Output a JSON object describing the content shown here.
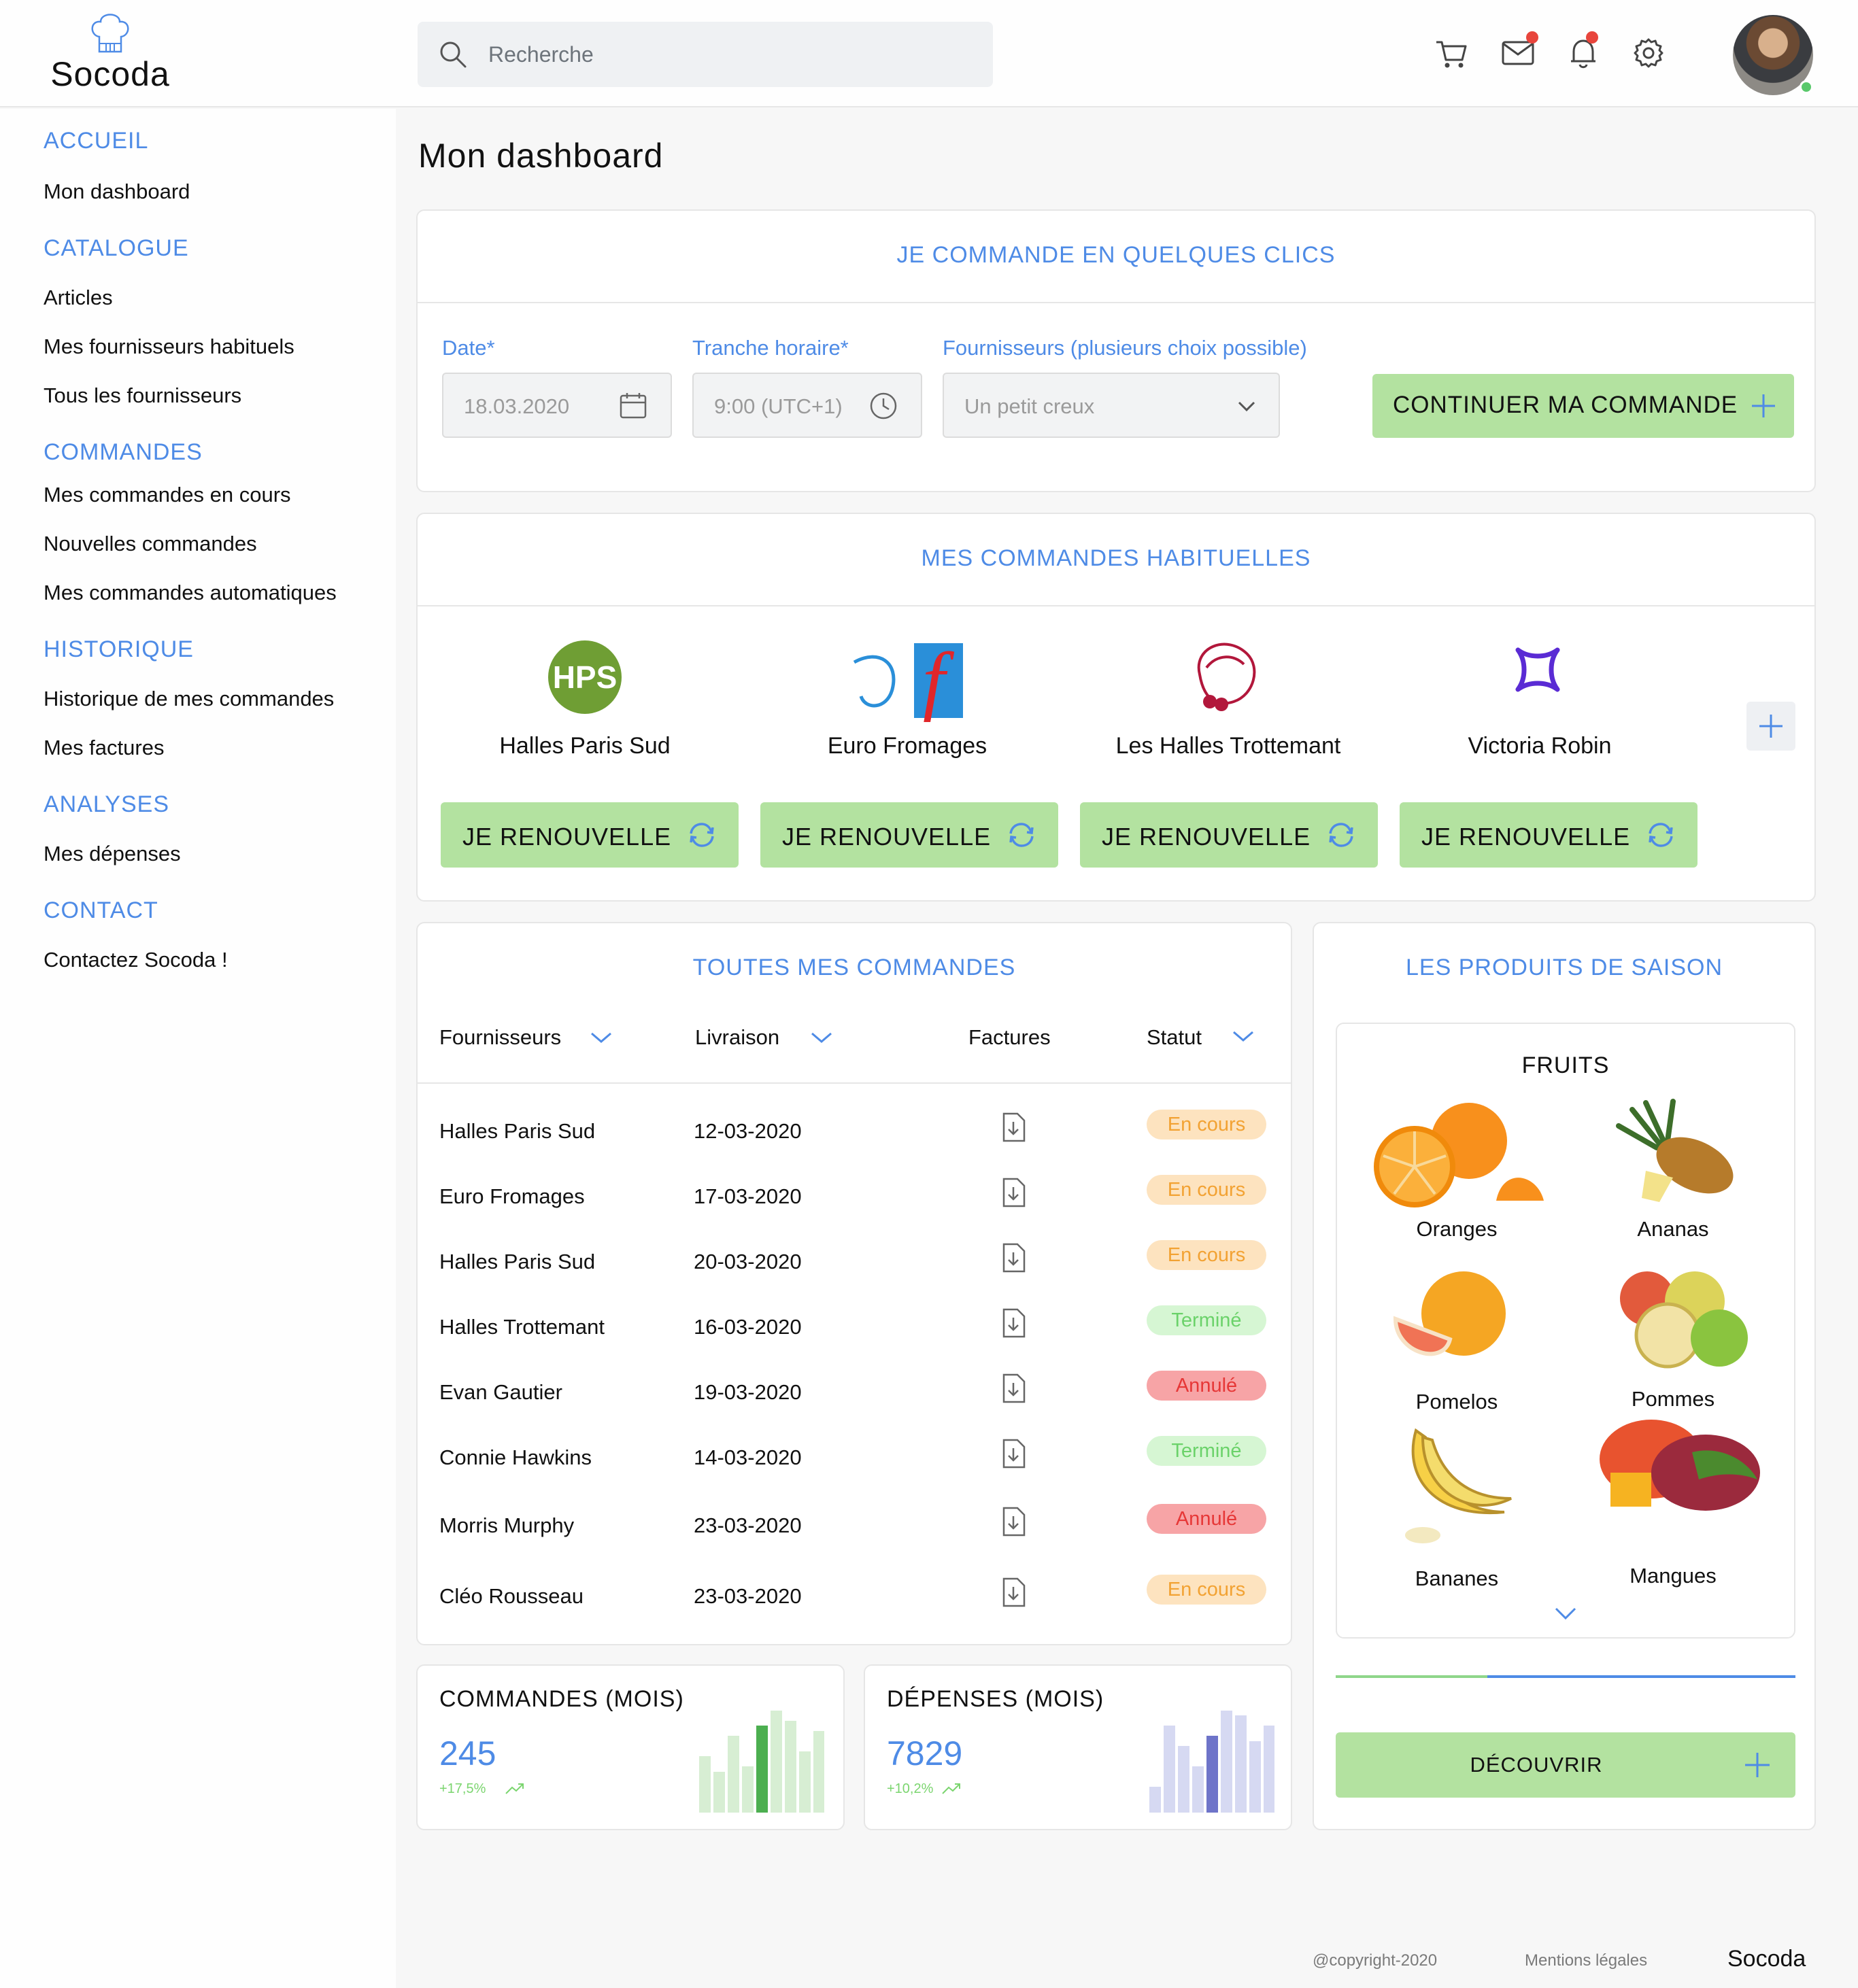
{
  "brand": {
    "name": "Socoda",
    "icon": "chef-hat-icon"
  },
  "search": {
    "placeholder": "Recherche"
  },
  "topbar": {
    "icons": [
      "cart-icon",
      "mail-icon",
      "bell-icon",
      "settings-icon"
    ],
    "user": "avatar"
  },
  "sidebar": {
    "sections": [
      {
        "title": "ACCUEIL",
        "items": [
          "Mon dashboard"
        ]
      },
      {
        "title": "CATALOGUE",
        "items": [
          "Articles",
          "Mes fournisseurs habituels",
          "Tous les fournisseurs"
        ]
      },
      {
        "title": "COMMANDES",
        "items": [
          "Mes commandes en cours",
          "Nouvelles commandes",
          "Mes commandes automatiques"
        ]
      },
      {
        "title": "HISTORIQUE",
        "items": [
          "Historique de mes commandes",
          "Mes factures"
        ]
      },
      {
        "title": "ANALYSES",
        "items": [
          "Mes dépenses"
        ]
      },
      {
        "title": "CONTACT",
        "items": [
          "Contactez Socoda !"
        ]
      }
    ]
  },
  "page_title": "Mon dashboard",
  "quick_order": {
    "title": "JE COMMANDE EN QUELQUES CLICS",
    "date_label": "Date*",
    "date_value": "18.03.2020",
    "time_label": "Tranche horaire*",
    "time_value": "9:00 (UTC+1)",
    "supplier_label": "Fournisseurs (plusieurs choix possible)",
    "supplier_value": "Un petit creux",
    "continue_label": "CONTINUER MA COMMANDE"
  },
  "habitual": {
    "title": "MES COMMANDES HABITUELLES",
    "suppliers": [
      {
        "name": "Halles Paris Sud",
        "logo_text": "HPS"
      },
      {
        "name": "Euro Fromages",
        "logo_text": "f"
      },
      {
        "name": "Les Halles Trottemant"
      },
      {
        "name": "Victoria Robin"
      }
    ],
    "renew_label": "JE RENOUVELLE"
  },
  "orders": {
    "title": "TOUTES MES COMMANDES",
    "headers": {
      "supplier": "Fournisseurs",
      "delivery": "Livraison",
      "invoices": "Factures",
      "status": "Statut"
    },
    "rows": [
      {
        "supplier": "Halles Paris Sud",
        "date": "12-03-2020",
        "status": "En cours",
        "kind": "cours"
      },
      {
        "supplier": "Euro Fromages",
        "date": "17-03-2020",
        "status": "En cours",
        "kind": "cours"
      },
      {
        "supplier": "Halles Paris Sud",
        "date": "20-03-2020",
        "status": "En cours",
        "kind": "cours"
      },
      {
        "supplier": "Halles Trottemant",
        "date": "16-03-2020",
        "status": "Terminé",
        "kind": "term"
      },
      {
        "supplier": "Evan Gautier",
        "date": "19-03-2020",
        "status": "Annulé",
        "kind": "ann"
      },
      {
        "supplier": "Connie Hawkins",
        "date": "14-03-2020",
        "status": "Terminé",
        "kind": "term"
      },
      {
        "supplier": "Morris Murphy",
        "date": "23-03-2020",
        "status": "Annulé",
        "kind": "ann"
      },
      {
        "supplier": "Cléo Rousseau",
        "date": "23-03-2020",
        "status": "En cours",
        "kind": "cours"
      }
    ]
  },
  "season": {
    "title": "LES PRODUITS DE SAISON",
    "category": "FRUITS",
    "fruits": [
      "Oranges",
      "Ananas",
      "Pomelos",
      "Pommes",
      "Bananes",
      "Mangues"
    ],
    "discover_label": "DÉCOUVRIR",
    "carousel_progress": 0.33
  },
  "kpis": [
    {
      "title": "COMMANDES (MOIS)",
      "value": "245",
      "delta": "+17,5%",
      "bars": [
        0.55,
        0.4,
        0.75,
        0.45,
        0.85,
        1.0,
        0.9,
        0.6,
        0.8
      ],
      "highlight": 4,
      "base": "#d7eed3",
      "accent": "#4caf50"
    },
    {
      "title": "DÉPENSES (MOIS)",
      "value": "7829",
      "delta": "+10,2%",
      "bars": [
        0.25,
        0.85,
        0.65,
        0.45,
        0.75,
        1.0,
        0.95,
        0.7,
        0.85
      ],
      "highlight": 4,
      "base": "#d6d9f2",
      "accent": "#6e74c9"
    }
  ],
  "footer": {
    "copyright": "@copyright-2020",
    "legal": "Mentions légales",
    "brand": "Socoda"
  },
  "colors": {
    "accent": "#4e8be6",
    "green_button": "#b3e2a0"
  }
}
